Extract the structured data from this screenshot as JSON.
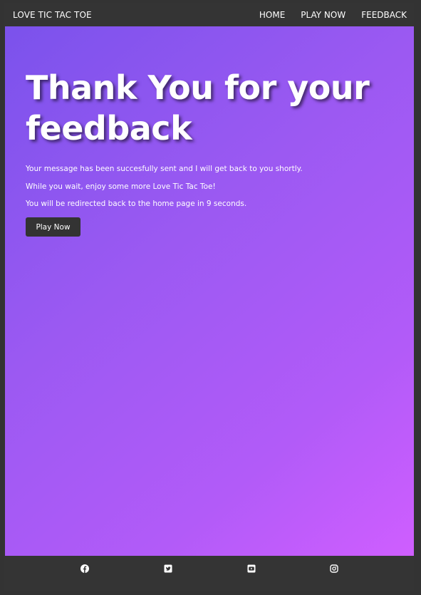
{
  "nav": {
    "brand": "LOVE TIC TAC TOE",
    "links": [
      {
        "label": "HOME"
      },
      {
        "label": "PLAY NOW"
      },
      {
        "label": "FEEDBACK"
      }
    ]
  },
  "hero": {
    "title": "Thank You for your feedback",
    "messages": [
      "Your message has been succesfully sent and I will get back to you shortly.",
      "While you wait, enjoy some more Love Tic Tac Toe!",
      "You will be redirected back to the home page in 9 seconds."
    ],
    "button_label": "Play Now",
    "gradient": [
      "#7b52ec",
      "#cf5eff"
    ]
  },
  "footer": {
    "icons": [
      "facebook-icon",
      "twitter-icon",
      "youtube-icon",
      "instagram-icon"
    ]
  },
  "colors": {
    "nav_bg": "#343434",
    "button_bg": "#333333",
    "text": "#ffffff"
  }
}
